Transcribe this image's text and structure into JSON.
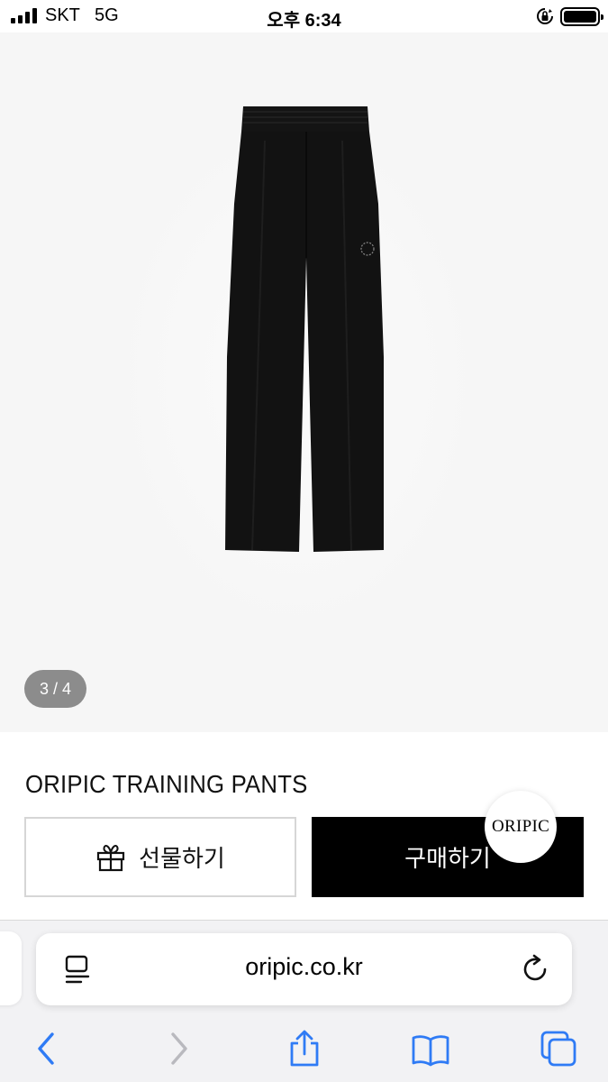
{
  "status_bar": {
    "carrier": "SKT",
    "network": "5G",
    "time": "오후 6:34",
    "icons": [
      "signal-icon",
      "orientation-lock-icon",
      "battery-icon"
    ]
  },
  "product": {
    "image_counter": "3 / 4",
    "title": "ORIPIC TRAINING PANTS",
    "gift_label": "선물하기",
    "buy_label": "구매하기",
    "brand_badge": "ORIPIC"
  },
  "browser": {
    "url": "oripic.co.kr",
    "toolbar": [
      "back-icon",
      "forward-icon",
      "share-icon",
      "bookmarks-icon",
      "tabs-icon"
    ]
  },
  "colors": {
    "accent": "#1a73e8",
    "buy_button": "#000000",
    "image_bg": "#f6f6f6",
    "toolbar_bg": "#f2f2f4"
  }
}
